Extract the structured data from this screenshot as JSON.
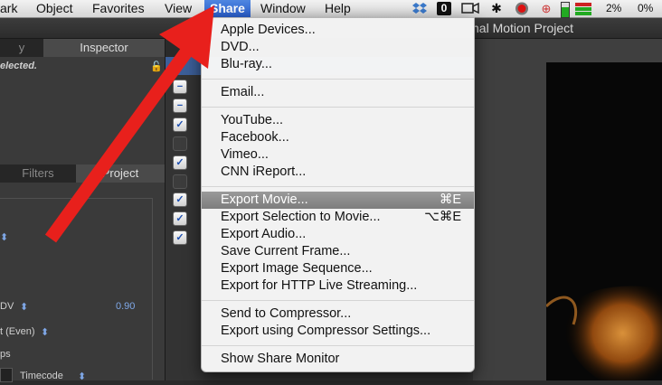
{
  "menubar": {
    "items": [
      "ark",
      "Object",
      "Favorites",
      "View",
      "Share",
      "Window",
      "Help"
    ],
    "status": {
      "cpu1": "2%",
      "cpu2": "0%"
    }
  },
  "window": {
    "title": "nal Motion Project"
  },
  "left_panel": {
    "tabs_top": {
      "left": "y",
      "inspector": "Inspector"
    },
    "selected_text": "elected.",
    "tabs_mid": {
      "filters": "Filters",
      "project": "Project"
    },
    "rows": {
      "r1_label": "DV",
      "r1_value": "0.90",
      "r2_label": "t (Even)",
      "r3_label": "ps",
      "r4_label": "Timecode"
    }
  },
  "middle_list": {
    "checks": [
      "minus",
      "minus",
      "check",
      "none",
      "check",
      "none",
      "check",
      "check",
      "check"
    ]
  },
  "share_menu": {
    "groups": [
      [
        "Apple Devices...",
        "DVD...",
        "Blu-ray..."
      ],
      [
        "Email..."
      ],
      [
        "YouTube...",
        "Facebook...",
        "Vimeo...",
        "CNN iReport..."
      ],
      [
        "Export Movie...",
        "Export Selection to Movie...",
        "Export Audio...",
        "Save Current Frame...",
        "Export Image Sequence...",
        "Export for HTTP Live Streaming..."
      ],
      [
        "Send to Compressor...",
        "Export using Compressor Settings..."
      ],
      [
        "Show Share Monitor"
      ]
    ],
    "shortcuts": {
      "export_movie": "⌘E",
      "export_selection": "⌥⌘E"
    },
    "highlighted": "Export Movie...",
    "highlight_color": "#8a8a8a"
  },
  "annotation": {
    "arrow_color": "#e8201c"
  }
}
